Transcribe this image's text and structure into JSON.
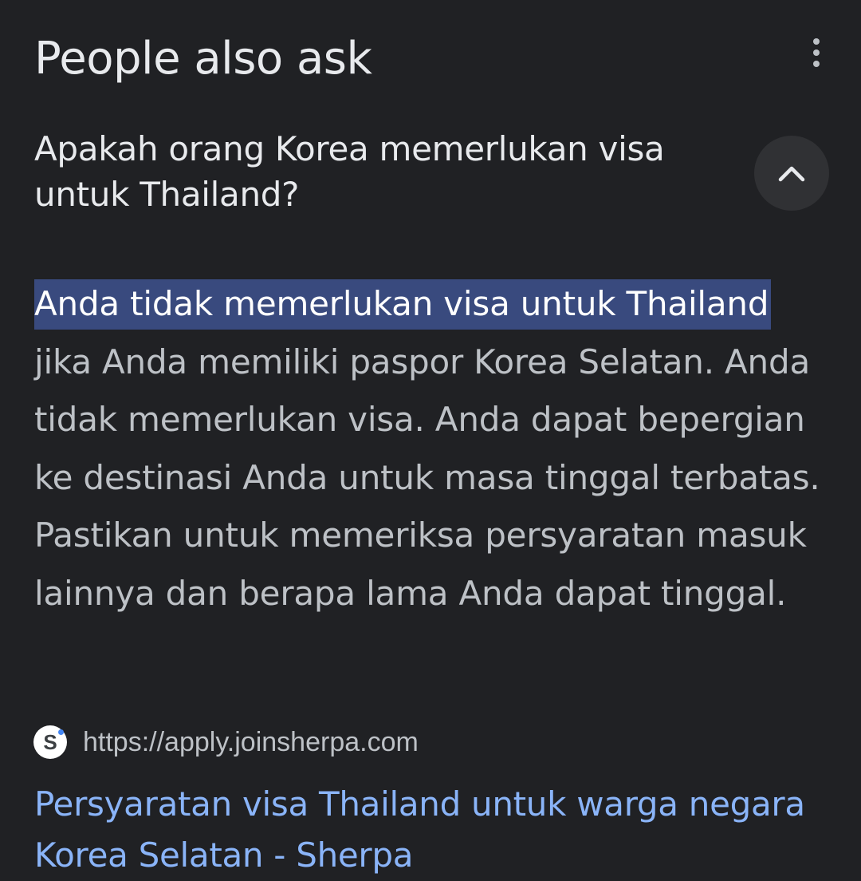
{
  "section": {
    "title": "People also ask",
    "more_icon": "more-vert-icon"
  },
  "question": {
    "text": "Apakah orang Korea memerlukan visa untuk Thailand?",
    "toggle_icon": "chevron-up-icon"
  },
  "answer": {
    "highlight": "Anda tidak memerlukan visa untuk Thailand",
    "body": " jika Anda memiliki paspor Korea Selatan. Anda tidak memerlukan visa. Anda dapat bepergian ke destinasi Anda untuk masa tinggal terbatas. Pastikan untuk memeriksa persyaratan masuk lainnya dan berapa lama Anda dapat tinggal."
  },
  "source": {
    "favicon_letter": "S",
    "url": "https://apply.joinsherpa.com"
  },
  "result": {
    "title": "Persyaratan visa Thailand untuk warga negara Korea Selatan - Sherpa"
  },
  "colors": {
    "background": "#202124",
    "link": "#8ab4f8",
    "highlight": "#394a7e"
  }
}
